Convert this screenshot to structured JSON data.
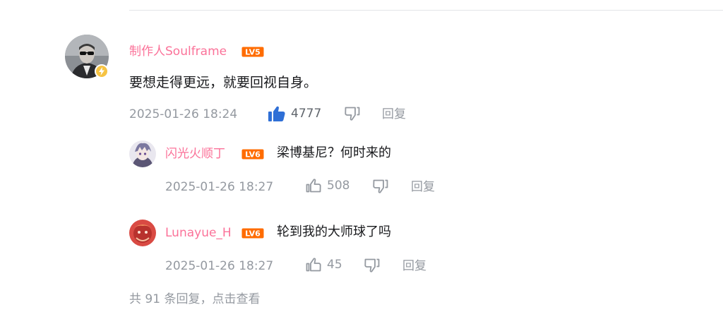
{
  "comment": {
    "username": "制作人Soulframe",
    "level": "LV5",
    "text": "要想走得更远，就要回视自身。",
    "timestamp": "2025-01-26 18:24",
    "likes": "4777",
    "reply_label": "回复",
    "liked": true
  },
  "replies": [
    {
      "username": "闪光火顺丁",
      "level": "LV6",
      "text": "梁博基尼？何时来的",
      "timestamp": "2025-01-26 18:27",
      "likes": "508",
      "reply_label": "回复"
    },
    {
      "username": "Lunayue_H",
      "level": "LV6",
      "text": "轮到我的大师球了吗",
      "timestamp": "2025-01-26 18:27",
      "likes": "45",
      "reply_label": "回复"
    }
  ],
  "view_more": "共 91 条回复，点击查看",
  "colors": {
    "username": "#fb7299",
    "meta": "#9499a0",
    "like_active": "#2f6fd6",
    "level_badge": "#ff6c00"
  },
  "icons": {
    "like": "thumbs-up-icon",
    "dislike": "thumbs-down-icon",
    "vip": "lightning-icon"
  }
}
